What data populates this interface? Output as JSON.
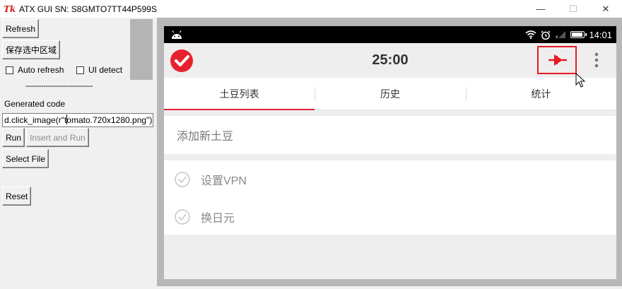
{
  "window": {
    "logo_text": "Tk",
    "title": "ATX GUI SN: S8GMTO7TT44P599S",
    "minimize_glyph": "—",
    "maximize_glyph": "☐",
    "close_glyph": "✕"
  },
  "controls": {
    "refresh_label": "Refresh",
    "save_region_label": "保存选中区域",
    "auto_refresh_label": "Auto refresh",
    "ui_detect_label": "UI detect",
    "separator": "------------------------------",
    "generated_code_label": "Generated code",
    "code_before_caret": "d.click_image(r\"t",
    "code_after_caret": "omato.720x1280.png\")",
    "run_label": "Run",
    "insert_run_label": "Insert and Run",
    "select_file_label": "Select File",
    "reset_label": "Reset",
    "auto_refresh_checked": false,
    "ui_detect_checked": false
  },
  "device": {
    "status": {
      "time": "14:01",
      "icons": [
        "android-icon",
        "wifi-icon",
        "alarm-icon",
        "signal-icon",
        "battery-icon"
      ]
    },
    "app": {
      "timer": "25:00",
      "logo_icon": "tomato-check-icon",
      "pin_icon": "pin-icon",
      "more_icon": "more-vert-icon",
      "accent": "#e51c23"
    },
    "tabs": [
      {
        "label": "土豆列表",
        "active": true
      },
      {
        "label": "历史",
        "active": false
      },
      {
        "label": "统计",
        "active": false
      }
    ],
    "add_placeholder": "添加新土豆",
    "tasks": [
      {
        "label": "设置VPN"
      },
      {
        "label": "换日元"
      }
    ]
  }
}
